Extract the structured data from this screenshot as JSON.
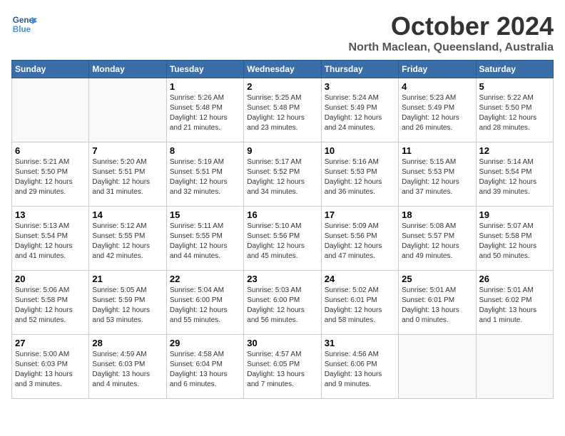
{
  "header": {
    "logo_line1": "General",
    "logo_line2": "Blue",
    "title": "October 2024",
    "subtitle": "North Maclean, Queensland, Australia"
  },
  "weekdays": [
    "Sunday",
    "Monday",
    "Tuesday",
    "Wednesday",
    "Thursday",
    "Friday",
    "Saturday"
  ],
  "weeks": [
    [
      {
        "day": "",
        "info": ""
      },
      {
        "day": "",
        "info": ""
      },
      {
        "day": "1",
        "info": "Sunrise: 5:26 AM\nSunset: 5:48 PM\nDaylight: 12 hours\nand 21 minutes."
      },
      {
        "day": "2",
        "info": "Sunrise: 5:25 AM\nSunset: 5:48 PM\nDaylight: 12 hours\nand 23 minutes."
      },
      {
        "day": "3",
        "info": "Sunrise: 5:24 AM\nSunset: 5:49 PM\nDaylight: 12 hours\nand 24 minutes."
      },
      {
        "day": "4",
        "info": "Sunrise: 5:23 AM\nSunset: 5:49 PM\nDaylight: 12 hours\nand 26 minutes."
      },
      {
        "day": "5",
        "info": "Sunrise: 5:22 AM\nSunset: 5:50 PM\nDaylight: 12 hours\nand 28 minutes."
      }
    ],
    [
      {
        "day": "6",
        "info": "Sunrise: 5:21 AM\nSunset: 5:50 PM\nDaylight: 12 hours\nand 29 minutes."
      },
      {
        "day": "7",
        "info": "Sunrise: 5:20 AM\nSunset: 5:51 PM\nDaylight: 12 hours\nand 31 minutes."
      },
      {
        "day": "8",
        "info": "Sunrise: 5:19 AM\nSunset: 5:51 PM\nDaylight: 12 hours\nand 32 minutes."
      },
      {
        "day": "9",
        "info": "Sunrise: 5:17 AM\nSunset: 5:52 PM\nDaylight: 12 hours\nand 34 minutes."
      },
      {
        "day": "10",
        "info": "Sunrise: 5:16 AM\nSunset: 5:53 PM\nDaylight: 12 hours\nand 36 minutes."
      },
      {
        "day": "11",
        "info": "Sunrise: 5:15 AM\nSunset: 5:53 PM\nDaylight: 12 hours\nand 37 minutes."
      },
      {
        "day": "12",
        "info": "Sunrise: 5:14 AM\nSunset: 5:54 PM\nDaylight: 12 hours\nand 39 minutes."
      }
    ],
    [
      {
        "day": "13",
        "info": "Sunrise: 5:13 AM\nSunset: 5:54 PM\nDaylight: 12 hours\nand 41 minutes."
      },
      {
        "day": "14",
        "info": "Sunrise: 5:12 AM\nSunset: 5:55 PM\nDaylight: 12 hours\nand 42 minutes."
      },
      {
        "day": "15",
        "info": "Sunrise: 5:11 AM\nSunset: 5:55 PM\nDaylight: 12 hours\nand 44 minutes."
      },
      {
        "day": "16",
        "info": "Sunrise: 5:10 AM\nSunset: 5:56 PM\nDaylight: 12 hours\nand 45 minutes."
      },
      {
        "day": "17",
        "info": "Sunrise: 5:09 AM\nSunset: 5:56 PM\nDaylight: 12 hours\nand 47 minutes."
      },
      {
        "day": "18",
        "info": "Sunrise: 5:08 AM\nSunset: 5:57 PM\nDaylight: 12 hours\nand 49 minutes."
      },
      {
        "day": "19",
        "info": "Sunrise: 5:07 AM\nSunset: 5:58 PM\nDaylight: 12 hours\nand 50 minutes."
      }
    ],
    [
      {
        "day": "20",
        "info": "Sunrise: 5:06 AM\nSunset: 5:58 PM\nDaylight: 12 hours\nand 52 minutes."
      },
      {
        "day": "21",
        "info": "Sunrise: 5:05 AM\nSunset: 5:59 PM\nDaylight: 12 hours\nand 53 minutes."
      },
      {
        "day": "22",
        "info": "Sunrise: 5:04 AM\nSunset: 6:00 PM\nDaylight: 12 hours\nand 55 minutes."
      },
      {
        "day": "23",
        "info": "Sunrise: 5:03 AM\nSunset: 6:00 PM\nDaylight: 12 hours\nand 56 minutes."
      },
      {
        "day": "24",
        "info": "Sunrise: 5:02 AM\nSunset: 6:01 PM\nDaylight: 12 hours\nand 58 minutes."
      },
      {
        "day": "25",
        "info": "Sunrise: 5:01 AM\nSunset: 6:01 PM\nDaylight: 13 hours\nand 0 minutes."
      },
      {
        "day": "26",
        "info": "Sunrise: 5:01 AM\nSunset: 6:02 PM\nDaylight: 13 hours\nand 1 minute."
      }
    ],
    [
      {
        "day": "27",
        "info": "Sunrise: 5:00 AM\nSunset: 6:03 PM\nDaylight: 13 hours\nand 3 minutes."
      },
      {
        "day": "28",
        "info": "Sunrise: 4:59 AM\nSunset: 6:03 PM\nDaylight: 13 hours\nand 4 minutes."
      },
      {
        "day": "29",
        "info": "Sunrise: 4:58 AM\nSunset: 6:04 PM\nDaylight: 13 hours\nand 6 minutes."
      },
      {
        "day": "30",
        "info": "Sunrise: 4:57 AM\nSunset: 6:05 PM\nDaylight: 13 hours\nand 7 minutes."
      },
      {
        "day": "31",
        "info": "Sunrise: 4:56 AM\nSunset: 6:06 PM\nDaylight: 13 hours\nand 9 minutes."
      },
      {
        "day": "",
        "info": ""
      },
      {
        "day": "",
        "info": ""
      }
    ]
  ]
}
